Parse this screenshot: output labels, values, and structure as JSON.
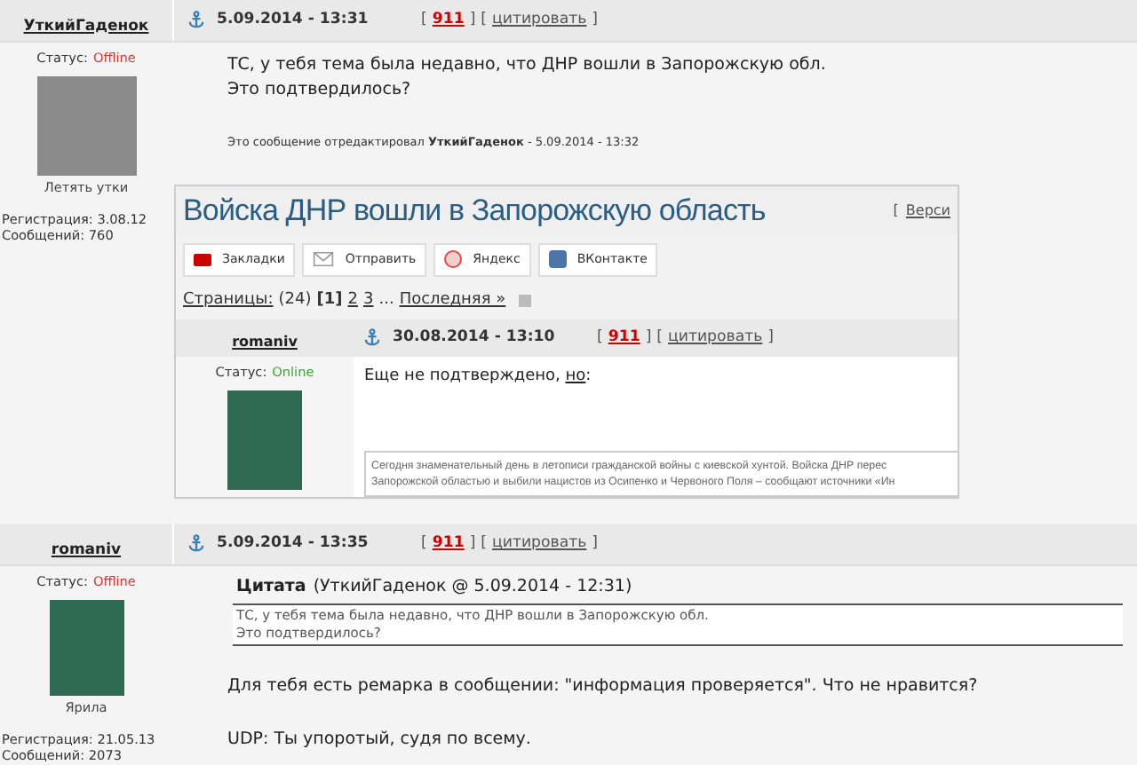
{
  "bracket_open": "[",
  "bracket_close": "]",
  "posts": [
    {
      "author": "УткийГаденок",
      "date": "5.09.2014 - 13:31",
      "rating": "911",
      "quote_link": "цитировать",
      "status_label": "Статус:",
      "status": "Offline",
      "online": false,
      "avatar_caption": "Летять утки",
      "registration": "Регистрация: 3.08.12",
      "messages": "Сообщений: 760",
      "blocks": [
        {
          "kind": "text",
          "lines": [
            "ТС, у тебя тема была недавно, что ДНР вошли в Запорожскую обл.",
            "Это подтвердилось?"
          ]
        },
        {
          "kind": "edit_note",
          "text": "Это сообщение отредактировал **УткийГаденок** - 5.09.2014 - 13:32"
        },
        {
          "kind": "embed",
          "title": "Войска ДНР вошли в Запорожскую область",
          "version_link": "Верси",
          "share_buttons": [
            {
              "kind": "bookmarks",
              "label": "Закладки"
            },
            {
              "kind": "mail",
              "label": "Отправить"
            },
            {
              "kind": "yandex",
              "label": "Яндекс"
            },
            {
              "kind": "vk",
              "label": "ВКонтакте"
            }
          ],
          "pages_label": "Страницы:",
          "pages_count": "(24)",
          "pages": [
            {
              "label": "[1]",
              "selected": true
            },
            {
              "label": "2",
              "selected": false
            },
            {
              "label": "3",
              "selected": false
            }
          ],
          "ellipsis": "...",
          "last_link": "Последняя »",
          "inner_post": {
            "author": "romaniv",
            "date": "30.08.2014 - 13:10",
            "rating": "911",
            "quote_link": "цитировать",
            "status_label": "Статус:",
            "status": "Online",
            "online": true,
            "text_before": "Еще не подтверждено, ",
            "link": "но",
            "text_after": ":",
            "quote_lines": [
              "Сегодня знаменательный день в летописи гражданской войны с киевской хунтой. Войска ДНР перес",
              "Запорожской областью и выбили нацистов из Осипенко и Червоного Поля – сообщают источники «Ин"
            ]
          }
        }
      ]
    },
    {
      "author": "romaniv",
      "date": "5.09.2014 - 13:35",
      "rating": "911",
      "quote_link": "цитировать",
      "status_label": "Статус:",
      "status": "Offline",
      "online": false,
      "avatar_caption": "Ярила",
      "registration": "Регистрация: 21.05.13",
      "messages": "Сообщений: 2073",
      "blocks": [
        {
          "kind": "quote",
          "label": "Цитата",
          "source": "(УткийГаденок @ 5.09.2014 - 12:31)",
          "lines": [
            "ТС, у тебя тема была недавно, что ДНР вошли в Запорожскую обл.",
            "Это подтвердилось?"
          ]
        },
        {
          "kind": "text",
          "lines": [
            "Для тебя есть ремарка в сообщении: \"информация проверяется\". Что не нравится?"
          ]
        },
        {
          "kind": "text",
          "lines": [
            "UDP: Ты упоротый, судя по всему."
          ]
        }
      ]
    }
  ]
}
